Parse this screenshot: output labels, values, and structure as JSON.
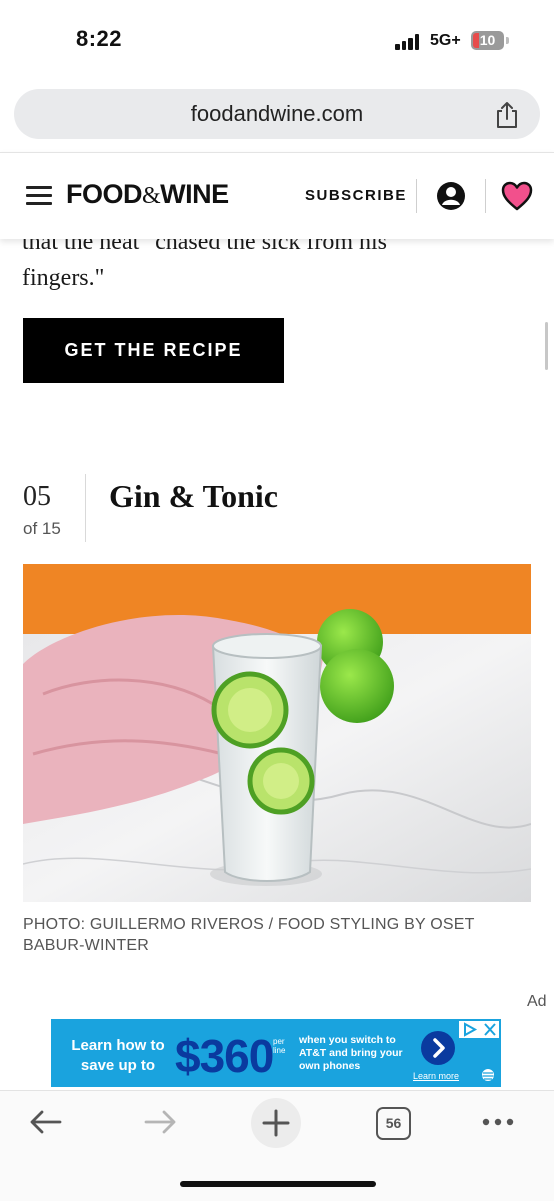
{
  "status_bar": {
    "time": "8:22",
    "network": "5G+",
    "battery": "10"
  },
  "browser": {
    "url": "foodandwine.com",
    "tab_count": "56"
  },
  "site_header": {
    "logo_left": "FOOD",
    "logo_amp": "&",
    "logo_right": "WINE",
    "subscribe_label": "SUBSCRIBE",
    "heart_color": "#f2508c"
  },
  "article": {
    "prev_text_line1": "that the heat \"chased the sick from his",
    "prev_text_line2": "fingers.\"",
    "recipe_button_label": "GET THE RECIPE",
    "item_number": "05",
    "item_of": "of 15",
    "item_title": "Gin & Tonic",
    "photo_alt": "Gin & Tonic",
    "photo_caption": "PHOTO: GUILLERMO RIVEROS / FOOD STYLING BY OSET BABUR-WINTER"
  },
  "ad": {
    "label": "Ad",
    "headline": "Learn how to save up to",
    "amount": "$360",
    "per_line": "per line",
    "copy": "when you switch to AT&T and bring your own phones",
    "learn_more": "Learn more"
  },
  "colors": {
    "ad_background": "#1aa3de",
    "ad_accent": "#0a3a9f",
    "photo_backdrop": "#ef8524"
  }
}
